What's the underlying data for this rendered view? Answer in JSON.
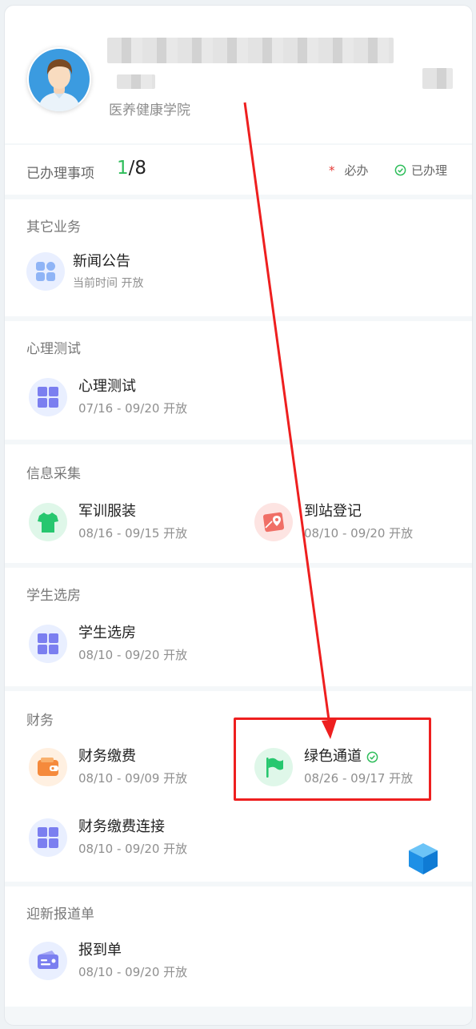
{
  "profile": {
    "college": "医养健康学院"
  },
  "progress": {
    "label": "已办理事项",
    "done": "1",
    "total": "/8",
    "required_star": "*",
    "required_label": "必办",
    "done_label": "已办理"
  },
  "sections": {
    "other": {
      "title": "其它业务",
      "items": [
        {
          "name": "新闻公告",
          "period": "当前时间 开放",
          "icon": "grid-icon"
        }
      ]
    },
    "psych": {
      "title": "心理测试",
      "items": [
        {
          "name": "心理测试",
          "period": "07/16 - 09/20 开放",
          "icon": "grid-icon"
        }
      ]
    },
    "info": {
      "title": "信息采集",
      "items": [
        {
          "name": "军训服装",
          "period": "08/16 - 09/15 开放",
          "icon": "tshirt-icon"
        },
        {
          "name": "到站登记",
          "period": "08/10 - 09/20 开放",
          "icon": "map-pin-icon"
        }
      ]
    },
    "dorm": {
      "title": "学生选房",
      "items": [
        {
          "name": "学生选房",
          "period": "08/10 - 09/20 开放",
          "icon": "grid-icon"
        }
      ]
    },
    "finance": {
      "title": "财务",
      "items": [
        {
          "name": "财务缴费",
          "period": "08/10 - 09/09 开放",
          "icon": "wallet-icon"
        },
        {
          "name": "绿色通道",
          "period": "08/26 - 09/17 开放",
          "icon": "flag-icon",
          "completed": true
        },
        {
          "name": "财务缴费连接",
          "period": "08/10 - 09/20 开放",
          "icon": "grid-icon"
        }
      ]
    },
    "report": {
      "title": "迎新报道单",
      "items": [
        {
          "name": "报到单",
          "period": "08/10 - 09/20 开放",
          "icon": "id-card-icon"
        }
      ]
    }
  },
  "colors": {
    "accent_green": "#2ebd5a",
    "annotation_red": "#ee1f1f",
    "icon_purple": "#7b7ff0"
  }
}
